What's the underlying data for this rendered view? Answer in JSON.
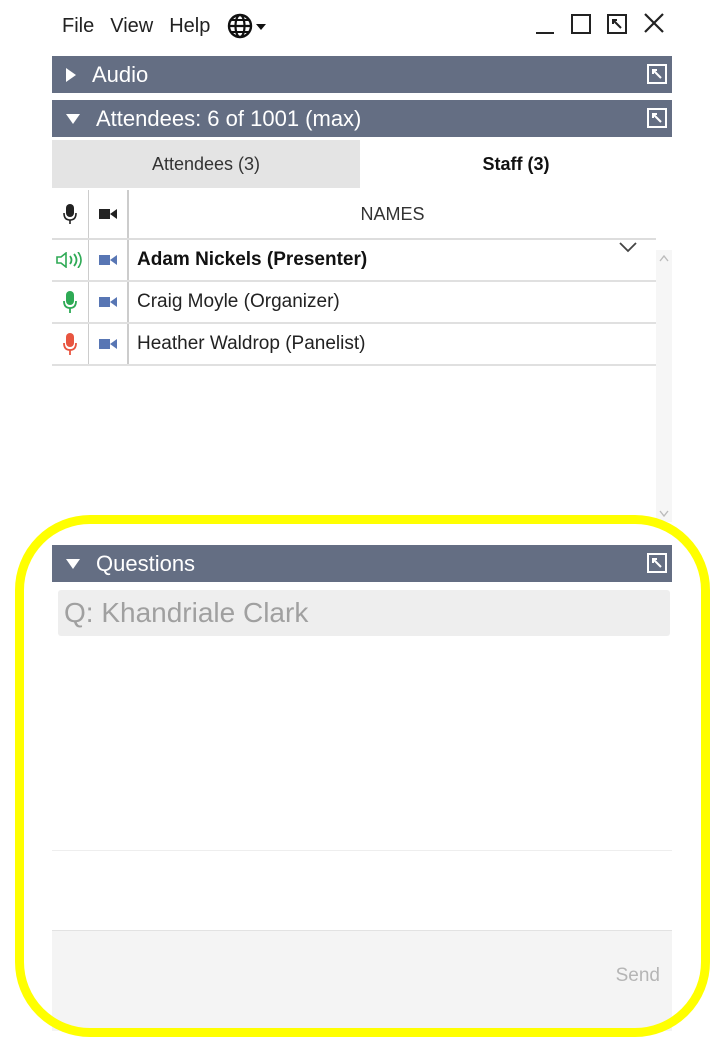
{
  "menu": {
    "items": [
      "File",
      "View",
      "Help"
    ]
  },
  "panels": {
    "audio": {
      "title": "Audio"
    },
    "attendees": {
      "title": "Attendees:  6 of 1001 (max)"
    },
    "questions": {
      "title": "Questions"
    }
  },
  "tabs": {
    "attendees_label": "Attendees (3)",
    "staff_label": "Staff (3)"
  },
  "table": {
    "names_header": "NAMES",
    "rows": [
      {
        "name": "Adam Nickels (Presenter)",
        "mic": "speaking",
        "bold": true
      },
      {
        "name": "Craig Moyle (Organizer)",
        "mic": "on",
        "bold": false
      },
      {
        "name": "Heather Waldrop (Panelist)",
        "mic": "muted",
        "bold": false
      }
    ]
  },
  "questions": {
    "selected_question": "Q: Khandriale Clark",
    "send_label": "Send"
  },
  "colors": {
    "panel_header": "#646e83",
    "mic_on": "#2eaa55",
    "mic_muted": "#e85540",
    "camera": "#5876b4",
    "highlight": "#ffff00"
  }
}
